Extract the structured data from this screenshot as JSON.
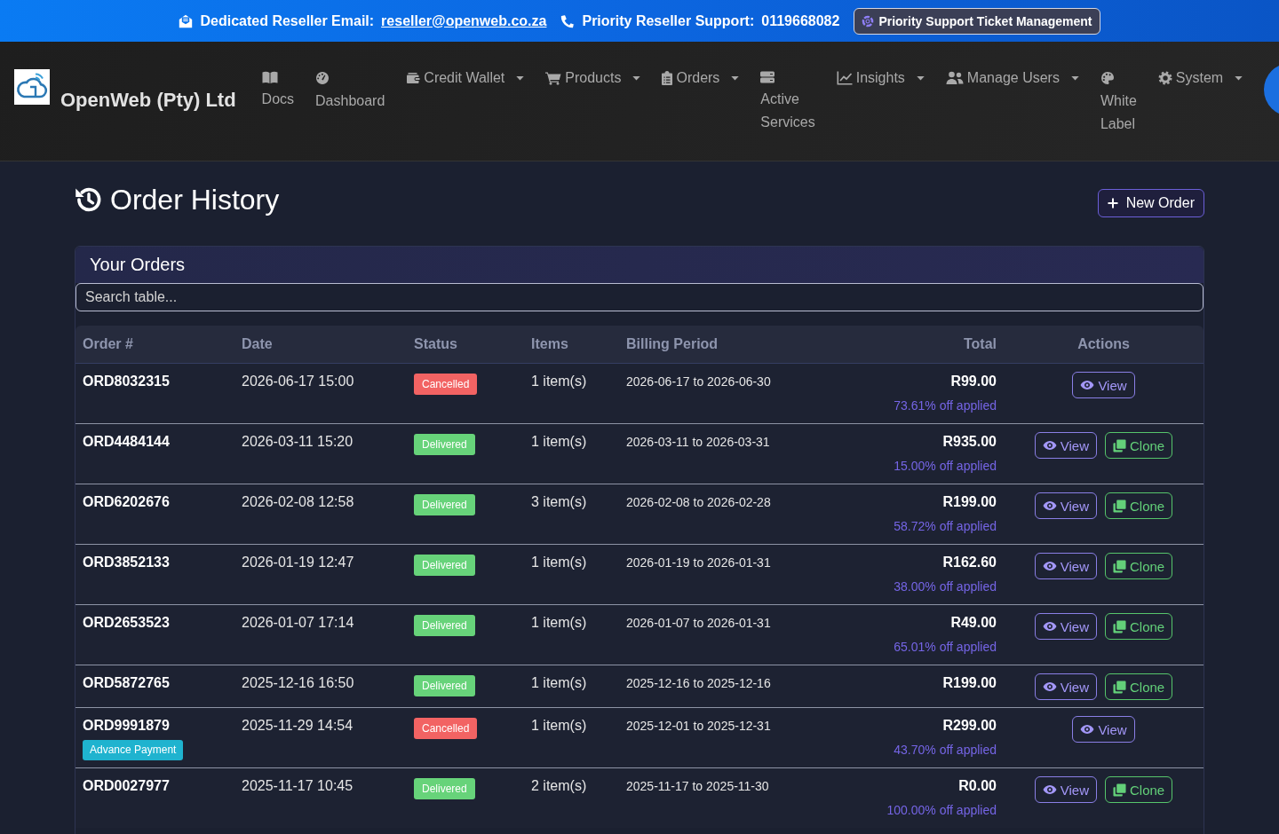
{
  "top_bar": {
    "email_label": "Dedicated Reseller Email:",
    "email": "reseller@openweb.co.za",
    "support_label": "Priority Reseller Support:",
    "support_phone": "0119668082",
    "ticket_button": "Priority Support Ticket Management"
  },
  "navbar": {
    "brand": "OpenWeb (Pty) Ltd",
    "items": [
      {
        "label": "Docs",
        "dropdown": false
      },
      {
        "label": "Dashboard",
        "dropdown": false
      },
      {
        "label": "Credit Wallet",
        "dropdown": true
      },
      {
        "label": "Products",
        "dropdown": true
      },
      {
        "label": "Orders",
        "dropdown": true
      },
      {
        "label": "Active Services",
        "dropdown": false
      },
      {
        "label": "Insights",
        "dropdown": true
      },
      {
        "label": "Manage Users",
        "dropdown": true
      },
      {
        "label": "White Label",
        "dropdown": false
      },
      {
        "label": "System",
        "dropdown": true
      }
    ]
  },
  "page": {
    "title": "Order History",
    "new_order_button": "New Order"
  },
  "orders_card": {
    "title": "Your Orders",
    "search": {
      "placeholder": "Search table..."
    },
    "table": {
      "columns": [
        "Order #",
        "Date",
        "Status",
        "Items",
        "Billing Period",
        "Total",
        "Actions"
      ],
      "rows": [
        {
          "order": "ORD8032315",
          "date": "2026-06-17 15:00",
          "status": {
            "label": "Cancelled",
            "color": "#f26363"
          },
          "items": "1 item(s)",
          "billing_period": "2026-06-17 to 2026-06-30",
          "total": "R99.00",
          "discount": "73.61% off applied",
          "actions": [
            {
              "label": "View",
              "kind": "view"
            }
          ]
        },
        {
          "order": "ORD4484144",
          "date": "2026-03-11 15:20",
          "status": {
            "label": "Delivered",
            "color": "#67d37a"
          },
          "items": "1 item(s)",
          "billing_period": "2026-03-11 to 2026-03-31",
          "total": "R935.00",
          "discount": "15.00% off applied",
          "actions": [
            {
              "label": "View",
              "kind": "view"
            },
            {
              "label": "Clone",
              "kind": "clone"
            }
          ]
        },
        {
          "order": "ORD6202676",
          "date": "2026-02-08 12:58",
          "status": {
            "label": "Delivered",
            "color": "#67d37a"
          },
          "items": "3 item(s)",
          "billing_period": "2026-02-08 to 2026-02-28",
          "total": "R199.00",
          "discount": "58.72% off applied",
          "actions": [
            {
              "label": "View",
              "kind": "view"
            },
            {
              "label": "Clone",
              "kind": "clone"
            }
          ]
        },
        {
          "order": "ORD3852133",
          "date": "2026-01-19 12:47",
          "status": {
            "label": "Delivered",
            "color": "#67d37a"
          },
          "items": "1 item(s)",
          "billing_period": "2026-01-19 to 2026-01-31",
          "total": "R162.60",
          "discount": "38.00% off applied",
          "actions": [
            {
              "label": "View",
              "kind": "view"
            },
            {
              "label": "Clone",
              "kind": "clone"
            }
          ]
        },
        {
          "order": "ORD2653523",
          "date": "2026-01-07 17:14",
          "status": {
            "label": "Delivered",
            "color": "#67d37a"
          },
          "items": "1 item(s)",
          "billing_period": "2026-01-07 to 2026-01-31",
          "total": "R49.00",
          "discount": "65.01% off applied",
          "actions": [
            {
              "label": "View",
              "kind": "view"
            },
            {
              "label": "Clone",
              "kind": "clone"
            }
          ]
        },
        {
          "order": "ORD5872765",
          "date": "2025-12-16 16:50",
          "status": {
            "label": "Delivered",
            "color": "#67d37a"
          },
          "items": "1 item(s)",
          "billing_period": "2025-12-16 to 2025-12-16",
          "total": "R199.00",
          "actions": [
            {
              "label": "View",
              "kind": "view"
            },
            {
              "label": "Clone",
              "kind": "clone"
            }
          ]
        },
        {
          "order": "ORD9991879",
          "tag": "Advance Payment",
          "date": "2025-11-29 14:54",
          "status": {
            "label": "Cancelled",
            "color": "#f26363"
          },
          "items": "1 item(s)",
          "billing_period": "2025-12-01 to 2025-12-31",
          "total": "R299.00",
          "discount": "43.70% off applied",
          "actions": [
            {
              "label": "View",
              "kind": "view"
            }
          ]
        },
        {
          "order": "ORD0027977",
          "date": "2025-11-17 10:45",
          "status": {
            "label": "Delivered",
            "color": "#67d37a"
          },
          "items": "2 item(s)",
          "billing_period": "2025-11-17 to 2025-11-30",
          "total": "R0.00",
          "discount": "100.00% off applied",
          "actions": [
            {
              "label": "View",
              "kind": "view"
            },
            {
              "label": "Clone",
              "kind": "clone"
            }
          ]
        }
      ]
    }
  }
}
